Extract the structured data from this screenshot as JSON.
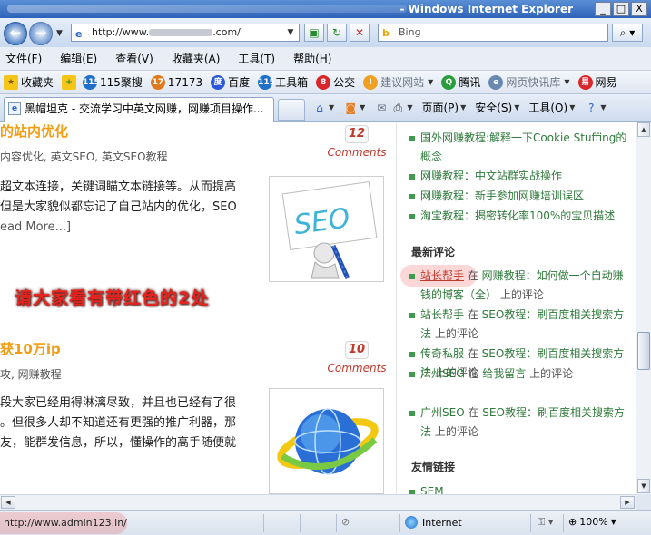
{
  "window": {
    "title": "- Windows Internet Explorer",
    "buttons": {
      "minimize": "_",
      "maximize": "□",
      "close": "X"
    }
  },
  "address": {
    "url_prefix": "http://www.",
    "url_suffix": ".com/",
    "search_engine": "Bing"
  },
  "menu": [
    "文件(F)",
    "编辑(E)",
    "查看(V)",
    "收藏夹(A)",
    "工具(T)",
    "帮助(H)"
  ],
  "favorites": {
    "label": "收藏夹",
    "items": [
      {
        "label": "115聚搜",
        "icon": "115",
        "color": "#1f6fc9"
      },
      {
        "label": "17173",
        "icon": "17",
        "color": "#e0791b"
      },
      {
        "label": "百度",
        "icon": "度",
        "color": "#2b58d8"
      },
      {
        "label": "工具箱",
        "icon": "115",
        "color": "#1f6fc9"
      },
      {
        "label": "公交",
        "icon": "8",
        "color": "#d8262a"
      },
      {
        "label": "建议网站",
        "icon": "!",
        "color": "#f0a020",
        "grey": true,
        "caret": true
      },
      {
        "label": "腾讯",
        "icon": "Q",
        "color": "#2a9d3c"
      },
      {
        "label": "网页快讯库",
        "icon": "e",
        "color": "#6a89b0",
        "grey": true,
        "caret": true
      },
      {
        "label": "网易",
        "icon": "易",
        "color": "#d8262a"
      }
    ]
  },
  "tab": {
    "title": "黑帽坦克 - 交流学习中英文网赚，网赚项目操作..."
  },
  "commandbar": {
    "page": "页面(P)",
    "safety": "安全(S)",
    "tools": "工具(O)"
  },
  "posts": [
    {
      "title": "的站内优化",
      "meta": "内容优化, 英文SEO, 英文SEO教程",
      "comments": "12",
      "comments_label": "Comments",
      "lines": [
        "超文本连接，关键词瞄文本链接等。从而提高",
        "但是大家貌似都忘记了自己站内的优化，SEO"
      ],
      "readmore": "ead More...]",
      "image_text": "SEO"
    },
    {
      "title": "获10万ip",
      "meta": "攻, 网赚教程",
      "comments": "10",
      "comments_label": "Comments",
      "lines": [
        "段大家已经用得淋漓尽致，并且也已经有了很",
        "。但很多人却不知道还有更强的推广利器，那",
        "友，能群发信息，所以，懂操作的高手随便就"
      ]
    }
  ],
  "annotation": "请大家看有带红色的2处",
  "sidebar": {
    "top_items": [
      {
        "text": "国外网赚教程:解释一下Cookie Stuffing的概念"
      },
      {
        "text": "网赚教程：中文站群实战操作"
      },
      {
        "text": "网赚教程：新手参加网赚培训误区"
      },
      {
        "text": "淘宝教程：揭密转化率100%的宝贝描述"
      }
    ],
    "recent_comments_heading": "最新评论",
    "recent_comments": [
      {
        "author": "站长帮手",
        "sep": " 在 ",
        "post": "网赚教程：如何做一个自动赚钱的博客（全）",
        "suffix": " 上的评论",
        "highlight": true
      },
      {
        "author": "站长帮手",
        "sep": " 在 ",
        "post": "SEO教程：刷百度相关搜索方法",
        "suffix": " 上的评论"
      },
      {
        "author": "传奇私服",
        "sep": " 在 ",
        "post": "SEO教程：刷百度相关搜索方法",
        "suffix": " 上的评论"
      },
      {
        "author": "广州SEO",
        "sep": " 在 ",
        "post": "给我留言",
        "suffix": " 上的评论"
      },
      {
        "author": "广州SEO",
        "sep": " 在 ",
        "post": "SEO教程：刷百度相关搜索方法",
        "suffix": " 上的评论"
      }
    ],
    "links_heading": "友情链接",
    "links": [
      {
        "text": "SEM"
      }
    ]
  },
  "status": {
    "url": "http://www.admin123.in/",
    "zone": "Internet",
    "zoom": "100%"
  },
  "colors": {
    "accent_orange": "#f39c12",
    "link_green": "#2f7a3b",
    "comment_red": "#c0392b"
  }
}
